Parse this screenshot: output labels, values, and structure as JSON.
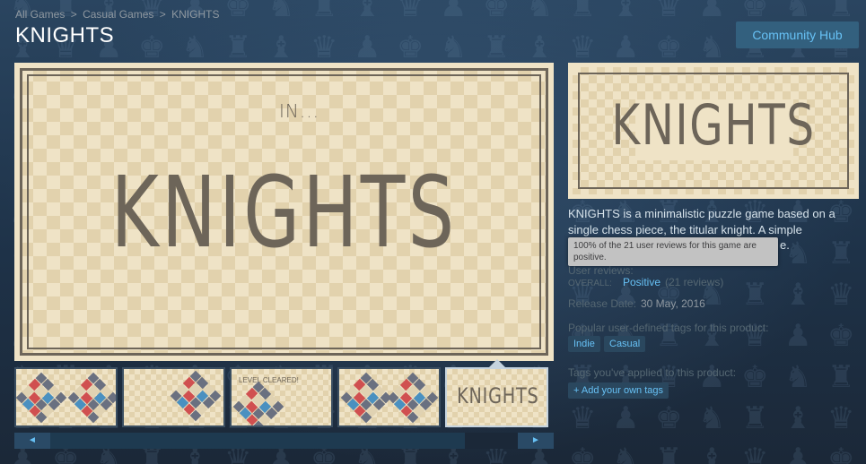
{
  "breadcrumb": {
    "items": [
      "All Games",
      "Casual Games",
      "KNIGHTS"
    ],
    "separator": ">"
  },
  "page_title": "KNIGHTS",
  "community_hub_label": "Community Hub",
  "main_screenshot": {
    "prefix": "IN...",
    "logo": "KNIGHTS"
  },
  "thumbnails": {
    "items": [
      {
        "caption": ""
      },
      {
        "caption": ""
      },
      {
        "caption": "LEVEL CLEARED!"
      },
      {
        "caption": ""
      },
      {
        "caption": "KNIGHTS"
      }
    ],
    "selected_index": 4
  },
  "slider": {
    "left_arrow": "◄",
    "right_arrow": "►"
  },
  "capsule": {
    "logo": "KNIGHTS"
  },
  "description": "KNIGHTS is a minimalistic puzzle game based on a single chess piece, the titular knight. A simple",
  "description_tail": "e.",
  "tooltip": "100% of the 21 user reviews for this game are positive.",
  "reviews": {
    "label": "User reviews:",
    "overall_label": "OVERALL:",
    "summary": "Positive",
    "count": "(21 reviews)"
  },
  "release": {
    "label": "Release Date:",
    "date": "30 May, 2016"
  },
  "tags": {
    "label": "Popular user-defined tags for this product:",
    "items": [
      "Indie",
      "Casual"
    ]
  },
  "my_tags": {
    "label": "Tags you've applied to this product:",
    "add_label": "+ Add your own tags"
  },
  "colors": {
    "background": "#1b2838",
    "accent": "#67c1f5",
    "board_light": "#efe3c6",
    "board_dark": "#e2d2ad",
    "ink": "#6d6559"
  },
  "icons": {
    "bg_pieces": [
      "♞",
      "♜",
      "♝",
      "♛",
      "♟",
      "♚"
    ]
  }
}
